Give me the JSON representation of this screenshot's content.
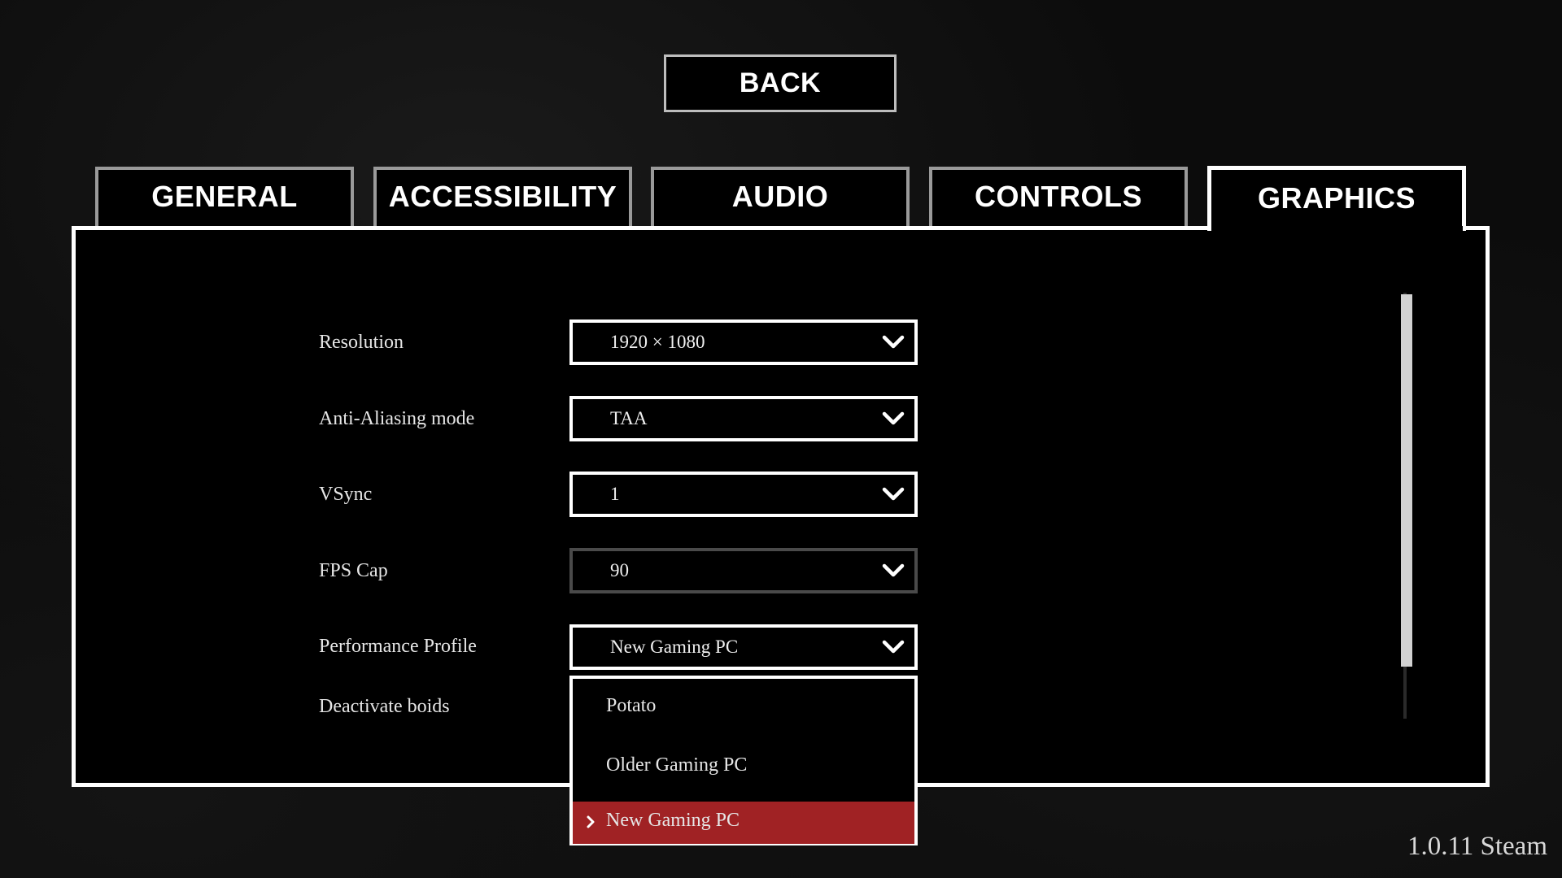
{
  "back_button": {
    "label": "BACK"
  },
  "tabs": [
    {
      "label": "GENERAL",
      "active": false
    },
    {
      "label": "ACCESSIBILITY",
      "active": false
    },
    {
      "label": "AUDIO",
      "active": false
    },
    {
      "label": "CONTROLS",
      "active": false
    },
    {
      "label": "GRAPHICS",
      "active": true
    }
  ],
  "settings": {
    "resolution": {
      "label": "Resolution",
      "value": "1920 × 1080",
      "icon": "chevron-down-icon"
    },
    "anti_aliasing": {
      "label": "Anti-Aliasing mode",
      "value": "TAA",
      "icon": "chevron-down-icon"
    },
    "vsync": {
      "label": "VSync",
      "value": "1",
      "icon": "chevron-down-icon"
    },
    "fps_cap": {
      "label": "FPS Cap",
      "value": "90",
      "icon": "chevron-down-icon"
    },
    "performance_profile": {
      "label": "Performance Profile",
      "value": "New Gaming PC",
      "icon": "chevron-down-icon"
    },
    "deactivate_boids": {
      "label": "Deactivate boids"
    }
  },
  "performance_dropdown": {
    "options": [
      "Potato",
      "Older Gaming PC",
      "New Gaming PC"
    ],
    "selected": "New Gaming PC",
    "selected_icon": "chevron-right-icon"
  },
  "colors": {
    "accent": "#a02224",
    "border": "#ffffff",
    "background": "#000000"
  },
  "version": "1.0.11 Steam"
}
